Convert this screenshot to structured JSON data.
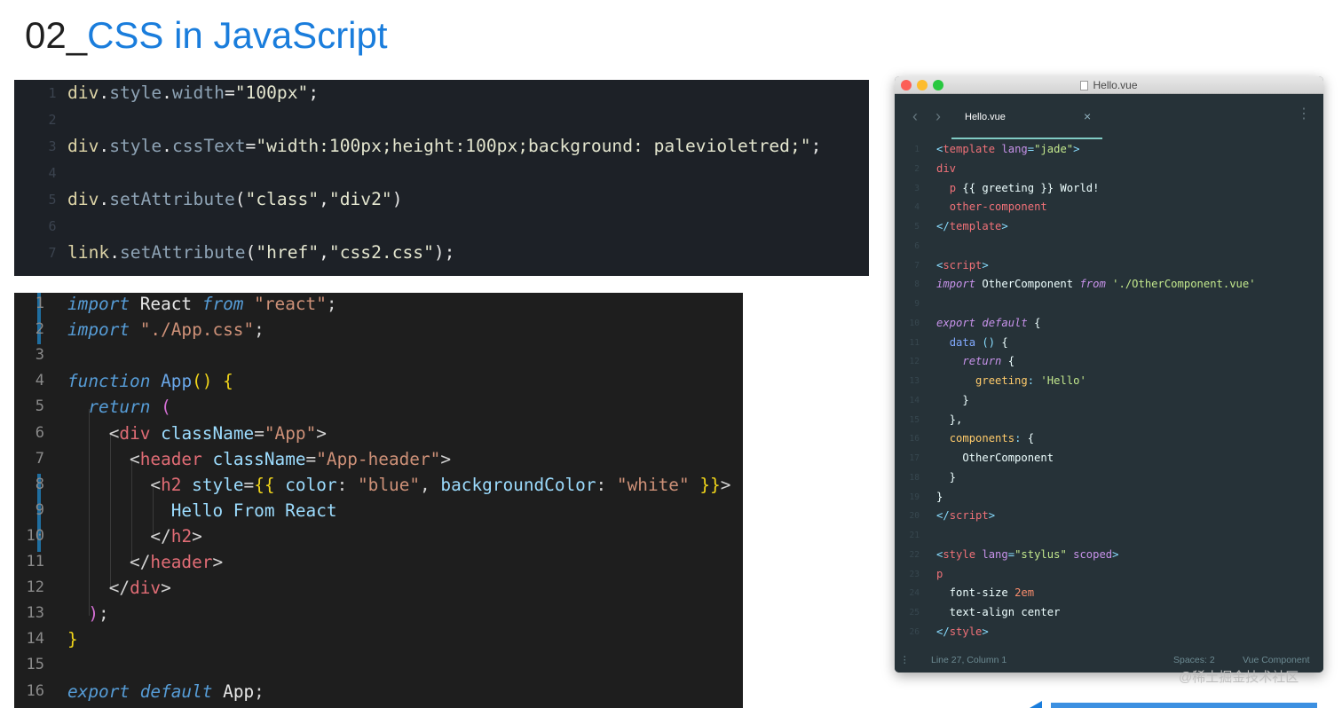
{
  "slide": {
    "title_num": "02_",
    "title_text": "CSS in JavaScript"
  },
  "panel1": {
    "lines": [
      {
        "n": "1",
        "t": [
          [
            "ident",
            "div"
          ],
          [
            "plain",
            "."
          ],
          [
            "prop",
            "style"
          ],
          [
            "plain",
            "."
          ],
          [
            "prop",
            "width"
          ],
          [
            "plain",
            "="
          ],
          [
            "str",
            "\"100px\""
          ],
          [
            "plain",
            ";"
          ]
        ]
      },
      {
        "n": "2",
        "t": []
      },
      {
        "n": "3",
        "t": [
          [
            "ident",
            "div"
          ],
          [
            "plain",
            "."
          ],
          [
            "prop",
            "style"
          ],
          [
            "plain",
            "."
          ],
          [
            "prop",
            "cssText"
          ],
          [
            "plain",
            "="
          ],
          [
            "str",
            "\"width:100px;height:100px;background: palevioletred;\""
          ],
          [
            "plain",
            ";"
          ]
        ]
      },
      {
        "n": "4",
        "t": []
      },
      {
        "n": "5",
        "t": [
          [
            "ident",
            "div"
          ],
          [
            "plain",
            "."
          ],
          [
            "prop",
            "setAttribute"
          ],
          [
            "plain",
            "("
          ],
          [
            "str",
            "\"class\""
          ],
          [
            "plain",
            ","
          ],
          [
            "str",
            "\"div2\""
          ],
          [
            "plain",
            ")"
          ]
        ]
      },
      {
        "n": "6",
        "t": []
      },
      {
        "n": "7",
        "t": [
          [
            "ident",
            "link"
          ],
          [
            "plain",
            "."
          ],
          [
            "prop",
            "setAttribute"
          ],
          [
            "plain",
            "("
          ],
          [
            "str",
            "\"href\""
          ],
          [
            "plain",
            ","
          ],
          [
            "str",
            "\"css2.css\""
          ],
          [
            "plain",
            ");"
          ]
        ]
      }
    ]
  },
  "panel2": {
    "lines": [
      {
        "n": "1",
        "t": [
          [
            "kw",
            "import"
          ],
          [
            "plain",
            " React "
          ],
          [
            "kw",
            "from"
          ],
          [
            "plain",
            " "
          ],
          [
            "str",
            "\"react\""
          ],
          [
            "pun",
            ";"
          ]
        ]
      },
      {
        "n": "2",
        "t": [
          [
            "kw",
            "import"
          ],
          [
            "plain",
            " "
          ],
          [
            "str",
            "\"./App.css\""
          ],
          [
            "pun",
            ";"
          ]
        ]
      },
      {
        "n": "3",
        "t": []
      },
      {
        "n": "4",
        "t": [
          [
            "kw",
            "function"
          ],
          [
            "plain",
            " "
          ],
          [
            "fn",
            "App"
          ],
          [
            "br",
            "()"
          ],
          [
            "plain",
            " "
          ],
          [
            "br",
            "{"
          ]
        ]
      },
      {
        "n": "5",
        "t": [
          [
            "plain",
            "  "
          ],
          [
            "kw",
            "return"
          ],
          [
            "plain",
            " "
          ],
          [
            "br2",
            "("
          ]
        ]
      },
      {
        "n": "6",
        "t": [
          [
            "plain",
            "    "
          ],
          [
            "pun",
            "<"
          ],
          [
            "tag",
            "div"
          ],
          [
            "plain",
            " "
          ],
          [
            "attr",
            "className"
          ],
          [
            "pun",
            "="
          ],
          [
            "str",
            "\"App\""
          ],
          [
            "pun",
            ">"
          ]
        ]
      },
      {
        "n": "7",
        "t": [
          [
            "plain",
            "      "
          ],
          [
            "pun",
            "<"
          ],
          [
            "tag",
            "header"
          ],
          [
            "plain",
            " "
          ],
          [
            "attr",
            "className"
          ],
          [
            "pun",
            "="
          ],
          [
            "str",
            "\"App-header\""
          ],
          [
            "pun",
            ">"
          ]
        ]
      },
      {
        "n": "8",
        "t": [
          [
            "plain",
            "        "
          ],
          [
            "pun",
            "<"
          ],
          [
            "tag",
            "h2"
          ],
          [
            "plain",
            " "
          ],
          [
            "attr",
            "style"
          ],
          [
            "pun",
            "="
          ],
          [
            "br",
            "{{"
          ],
          [
            "plain",
            " "
          ],
          [
            "attr",
            "color"
          ],
          [
            "pun",
            ":"
          ],
          [
            "plain",
            " "
          ],
          [
            "str",
            "\"blue\""
          ],
          [
            "pun",
            ","
          ],
          [
            "plain",
            " "
          ],
          [
            "attr",
            "backgroundColor"
          ],
          [
            "pun",
            ":"
          ],
          [
            "plain",
            " "
          ],
          [
            "str",
            "\"white\""
          ],
          [
            "plain",
            " "
          ],
          [
            "br",
            "}}"
          ],
          [
            "pun",
            ">"
          ]
        ]
      },
      {
        "n": "9",
        "t": [
          [
            "plain",
            "          "
          ],
          [
            "txt",
            "Hello From React"
          ]
        ]
      },
      {
        "n": "10",
        "t": [
          [
            "plain",
            "        "
          ],
          [
            "pun",
            "</"
          ],
          [
            "tag",
            "h2"
          ],
          [
            "pun",
            ">"
          ]
        ]
      },
      {
        "n": "11",
        "t": [
          [
            "plain",
            "      "
          ],
          [
            "pun",
            "</"
          ],
          [
            "tag",
            "header"
          ],
          [
            "pun",
            ">"
          ]
        ]
      },
      {
        "n": "12",
        "t": [
          [
            "plain",
            "    "
          ],
          [
            "pun",
            "</"
          ],
          [
            "tag",
            "div"
          ],
          [
            "pun",
            ">"
          ]
        ]
      },
      {
        "n": "13",
        "t": [
          [
            "plain",
            "  "
          ],
          [
            "br2",
            ")"
          ],
          [
            "pun",
            ";"
          ]
        ]
      },
      {
        "n": "14",
        "t": [
          [
            "br",
            "}"
          ]
        ]
      },
      {
        "n": "15",
        "t": []
      },
      {
        "n": "16",
        "t": [
          [
            "kw",
            "export"
          ],
          [
            "plain",
            " "
          ],
          [
            "kw",
            "default"
          ],
          [
            "plain",
            " App"
          ],
          [
            "pun",
            ";"
          ]
        ]
      }
    ]
  },
  "editor": {
    "window_title": "Hello.vue",
    "tab_label": "Hello.vue",
    "tab_close": "×",
    "status": {
      "position": "Line 27, Column 1",
      "spaces": "Spaces: 2",
      "syntax": "Vue Component"
    },
    "lines": [
      {
        "n": "1",
        "t": [
          [
            "pun",
            "<"
          ],
          [
            "tag",
            "template"
          ],
          [
            "txt",
            " "
          ],
          [
            "attr",
            "lang"
          ],
          [
            "pun",
            "="
          ],
          [
            "str",
            "\"jade\""
          ],
          [
            "pun",
            ">"
          ]
        ]
      },
      {
        "n": "2",
        "t": [
          [
            "tag",
            "div"
          ]
        ]
      },
      {
        "n": "3",
        "t": [
          [
            "txt",
            "  "
          ],
          [
            "tag",
            "p"
          ],
          [
            "txt",
            " {{ greeting }} World!"
          ]
        ]
      },
      {
        "n": "4",
        "t": [
          [
            "txt",
            "  "
          ],
          [
            "tag",
            "other-component"
          ]
        ]
      },
      {
        "n": "5",
        "t": [
          [
            "pun",
            "</"
          ],
          [
            "tag",
            "template"
          ],
          [
            "pun",
            ">"
          ]
        ]
      },
      {
        "n": "6",
        "t": []
      },
      {
        "n": "7",
        "t": [
          [
            "pun",
            "<"
          ],
          [
            "tag",
            "script"
          ],
          [
            "pun",
            ">"
          ]
        ]
      },
      {
        "n": "8",
        "t": [
          [
            "kw",
            "import"
          ],
          [
            "txt",
            " OtherComponent "
          ],
          [
            "kw",
            "from"
          ],
          [
            "txt",
            " "
          ],
          [
            "str",
            "'./OtherComponent.vue'"
          ]
        ]
      },
      {
        "n": "9",
        "t": []
      },
      {
        "n": "10",
        "t": [
          [
            "kw",
            "export default"
          ],
          [
            "txt",
            " {"
          ]
        ]
      },
      {
        "n": "11",
        "t": [
          [
            "txt",
            "  "
          ],
          [
            "fn",
            "data"
          ],
          [
            "txt",
            " "
          ],
          [
            "pun",
            "()"
          ],
          [
            "txt",
            " {"
          ]
        ]
      },
      {
        "n": "12",
        "t": [
          [
            "txt",
            "    "
          ],
          [
            "kw",
            "return"
          ],
          [
            "txt",
            " {"
          ]
        ]
      },
      {
        "n": "13",
        "t": [
          [
            "txt",
            "      "
          ],
          [
            "prop",
            "greeting"
          ],
          [
            "pun",
            ":"
          ],
          [
            "txt",
            " "
          ],
          [
            "str",
            "'Hello'"
          ]
        ]
      },
      {
        "n": "14",
        "t": [
          [
            "txt",
            "    }"
          ]
        ]
      },
      {
        "n": "15",
        "t": [
          [
            "txt",
            "  },"
          ]
        ]
      },
      {
        "n": "16",
        "t": [
          [
            "txt",
            "  "
          ],
          [
            "prop",
            "components"
          ],
          [
            "pun",
            ":"
          ],
          [
            "txt",
            " {"
          ]
        ]
      },
      {
        "n": "17",
        "t": [
          [
            "txt",
            "    OtherComponent"
          ]
        ]
      },
      {
        "n": "18",
        "t": [
          [
            "txt",
            "  }"
          ]
        ]
      },
      {
        "n": "19",
        "t": [
          [
            "txt",
            "}"
          ]
        ]
      },
      {
        "n": "20",
        "t": [
          [
            "pun",
            "</"
          ],
          [
            "tag",
            "script"
          ],
          [
            "pun",
            ">"
          ]
        ]
      },
      {
        "n": "21",
        "t": []
      },
      {
        "n": "22",
        "t": [
          [
            "pun",
            "<"
          ],
          [
            "tag",
            "style"
          ],
          [
            "txt",
            " "
          ],
          [
            "attr",
            "lang"
          ],
          [
            "pun",
            "="
          ],
          [
            "str",
            "\"stylus\""
          ],
          [
            "txt",
            " "
          ],
          [
            "attr",
            "scoped"
          ],
          [
            "pun",
            ">"
          ]
        ]
      },
      {
        "n": "23",
        "t": [
          [
            "tag",
            "p"
          ]
        ]
      },
      {
        "n": "24",
        "t": [
          [
            "txt",
            "  font-size "
          ],
          [
            "num",
            "2em"
          ]
        ]
      },
      {
        "n": "25",
        "t": [
          [
            "txt",
            "  text-align center"
          ]
        ]
      },
      {
        "n": "26",
        "t": [
          [
            "pun",
            "</"
          ],
          [
            "tag",
            "style"
          ],
          [
            "pun",
            ">"
          ]
        ]
      }
    ]
  },
  "watermark": "@稀土掘金技术社区",
  "colors": {
    "title_accent": "#1a7ddc",
    "panel1_bg": "#1d2127",
    "panel2_bg": "#1e1e1e",
    "editor_bg": "#263238"
  }
}
